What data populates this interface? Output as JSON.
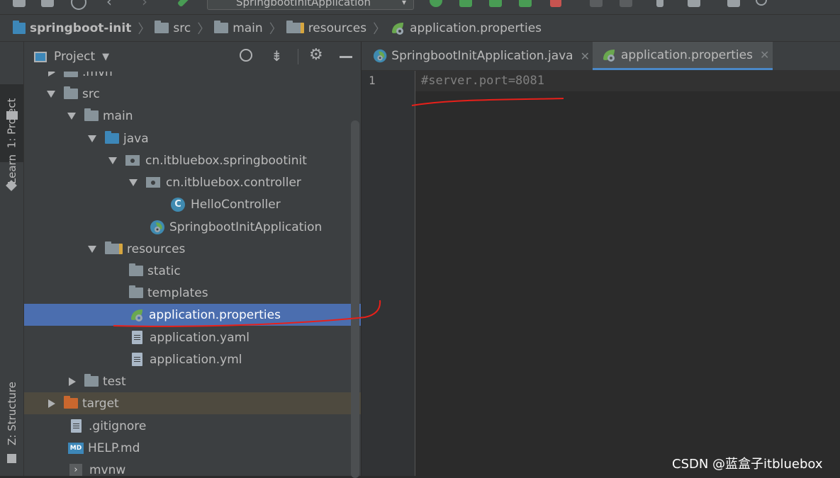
{
  "toolbar": {
    "run_config": "SpringbootInitApplication"
  },
  "breadcrumb": {
    "items": [
      "springboot-init",
      "src",
      "main",
      "resources",
      "application.properties"
    ]
  },
  "left_stripe": {
    "project_tab": "1: Project",
    "learn_tab": "Learn",
    "structure_tab": "Z: Structure"
  },
  "project_panel": {
    "title": "Project",
    "tree": [
      {
        "label": ".mvn"
      },
      {
        "label": "src"
      },
      {
        "label": "main"
      },
      {
        "label": "java"
      },
      {
        "label": "cn.itbluebox.springbootinit"
      },
      {
        "label": "cn.itbluebox.controller"
      },
      {
        "label": "HelloController"
      },
      {
        "label": "SpringbootInitApplication"
      },
      {
        "label": "resources"
      },
      {
        "label": "static"
      },
      {
        "label": "templates"
      },
      {
        "label": "application.properties"
      },
      {
        "label": "application.yaml"
      },
      {
        "label": "application.yml"
      },
      {
        "label": "test"
      },
      {
        "label": "target"
      },
      {
        "label": ".gitignore"
      },
      {
        "label": "HELP.md"
      },
      {
        "label": "mvnw"
      }
    ]
  },
  "editor": {
    "tabs": [
      {
        "label": "SpringbootInitApplication.java"
      },
      {
        "label": "application.properties"
      }
    ],
    "line_number": "1",
    "code_line": "#server.port=8081"
  },
  "watermark": "CSDN @蓝盒子itbluebox",
  "colors": {
    "panel_bg": "#3c3f41",
    "editor_bg": "#2b2b2b",
    "selection": "#4b6eaf",
    "annotation_red": "#e8201a"
  }
}
